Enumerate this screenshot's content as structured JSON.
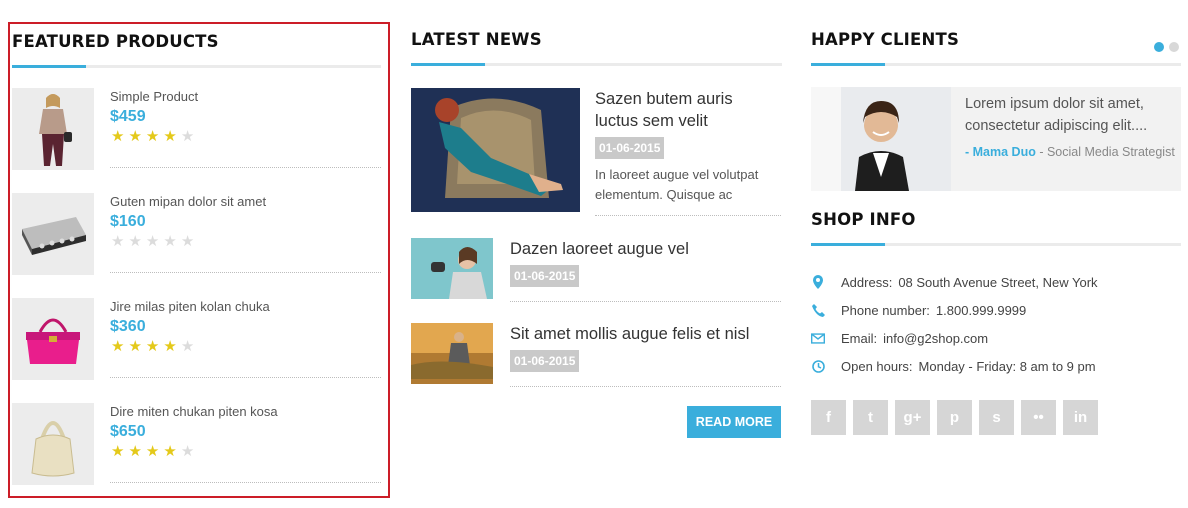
{
  "featured": {
    "title": "FEATURED PRODUCTS",
    "products": [
      {
        "name": "Simple Product",
        "price": "$459",
        "rating": 4,
        "max_rating": 5,
        "image": "woman-fashion-image"
      },
      {
        "name": "Guten mipan dolor sit amet",
        "price": "$160",
        "rating": 0,
        "max_rating": 5,
        "image": "audio-device-image"
      },
      {
        "name": "Jire milas piten kolan chuka",
        "price": "$360",
        "rating": 4,
        "max_rating": 5,
        "image": "pink-handbag-image"
      },
      {
        "name": "Dire miten chukan piten kosa",
        "price": "$650",
        "rating": 4,
        "max_rating": 5,
        "image": "beige-handbag-image"
      }
    ]
  },
  "news": {
    "title": "LATEST NEWS",
    "items": [
      {
        "title": "Sazen butem auris luctus sem velit",
        "date": "01-06-2015",
        "excerpt": "In laoreet augue vel volutpat elementum. Quisque ac"
      },
      {
        "title": "Dazen laoreet augue vel",
        "date": "01-06-2015"
      },
      {
        "title": "Sit amet mollis augue felis et nisl",
        "date": "01-06-2015"
      }
    ],
    "read_more": "READ MORE"
  },
  "clients": {
    "title": "HAPPY CLIENTS",
    "quote": "Lorem ipsum dolor sit amet, consectetur adipiscing elit....",
    "author_prefix": "- ",
    "author_name": "Mama Duo",
    "author_sep": " - ",
    "author_role": "Social Media Strategist",
    "slides": 2,
    "active_slide": 0
  },
  "shop": {
    "title": "SHOP INFO",
    "rows": [
      {
        "icon": "map-pin-icon",
        "label": "Address:",
        "value": "08 South Avenue Street, New York"
      },
      {
        "icon": "phone-icon",
        "label": "Phone number:",
        "value": "1.800.999.9999"
      },
      {
        "icon": "envelope-icon",
        "label": "Email:",
        "value": "info@g2shop.com"
      },
      {
        "icon": "clock-icon",
        "label": "Open hours:",
        "value": "Monday - Friday: 8 am to 9 pm"
      }
    ],
    "socials": [
      {
        "icon": "facebook-icon",
        "glyph": "f"
      },
      {
        "icon": "twitter-icon",
        "glyph": "t"
      },
      {
        "icon": "google-plus-icon",
        "glyph": "g+"
      },
      {
        "icon": "pinterest-icon",
        "glyph": "p"
      },
      {
        "icon": "skype-icon",
        "glyph": "s"
      },
      {
        "icon": "flickr-icon",
        "glyph": "••"
      },
      {
        "icon": "linkedin-icon",
        "glyph": "in"
      }
    ]
  },
  "colors": {
    "accent": "#3aaedc",
    "highlight_border": "#cc1d28",
    "star": "#e4c91a",
    "date_bg": "#c9c9c9"
  }
}
